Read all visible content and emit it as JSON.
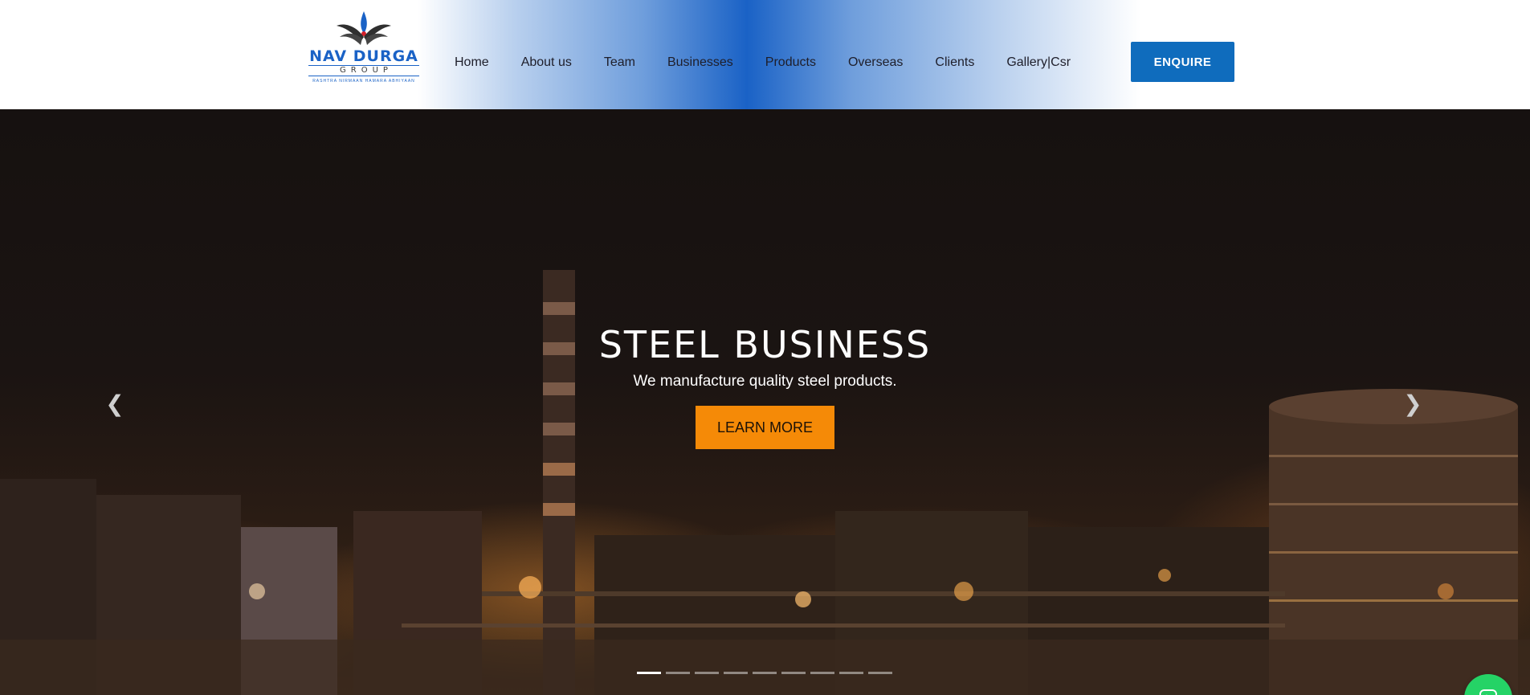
{
  "brand": {
    "name": "NAV DURGA",
    "group": "GROUP",
    "tagline": "RASHTRA NIRMAAN HAMARA ABHIYAAN",
    "logo_icon": "lotus-flame-icon",
    "color": "#1a62c6"
  },
  "nav": {
    "items": [
      {
        "label": "Home"
      },
      {
        "label": "About us"
      },
      {
        "label": "Team"
      },
      {
        "label": "Businesses"
      },
      {
        "label": "Products"
      },
      {
        "label": "Overseas"
      },
      {
        "label": "Clients"
      },
      {
        "label": "Gallery|Csr"
      }
    ]
  },
  "header": {
    "enquire_label": "ENQUIRE",
    "enquire_color": "#0f6cbd"
  },
  "hero": {
    "title": "STEEL BUSINESS",
    "subtitle": "We manufacture quality steel products.",
    "cta_label": "LEARN MORE",
    "cta_color": "#f58a07",
    "prev_icon": "chevron-left-icon",
    "next_icon": "chevron-right-icon",
    "slide_count": 9,
    "active_slide": 1
  },
  "floating": {
    "whatsapp_icon": "whatsapp-icon",
    "color": "#25d366"
  }
}
